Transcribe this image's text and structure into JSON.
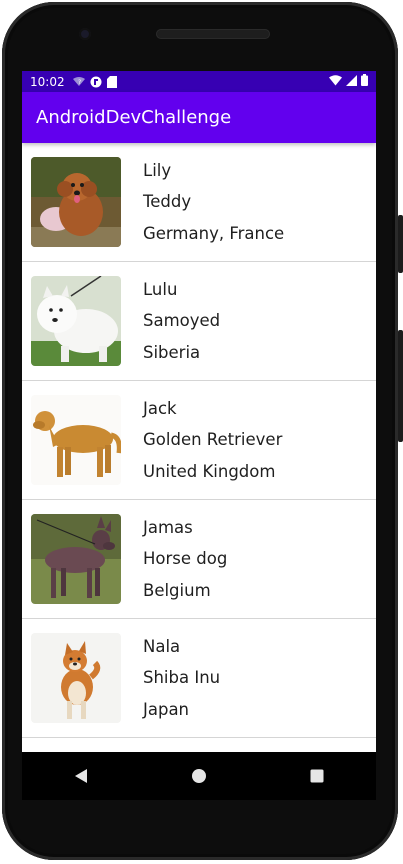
{
  "status_bar": {
    "time": "10:02",
    "icons_left": [
      "wifi-question-icon",
      "app-notification-icon",
      "sd-card-icon"
    ],
    "icons_right": [
      "wifi-icon",
      "signal-icon",
      "battery-icon"
    ]
  },
  "app_bar": {
    "title": "AndroidDevChallenge",
    "color": "#6200ee",
    "status_color": "#3700b3"
  },
  "dogs": [
    {
      "name": "Lily",
      "breed": "Teddy",
      "origin": "Germany, France",
      "image": "brown-poodle-photo"
    },
    {
      "name": "Lulu",
      "breed": "Samoyed",
      "origin": "Siberia",
      "image": "white-samoyed-photo"
    },
    {
      "name": "Jack",
      "breed": "Golden Retriever",
      "origin": "United Kingdom",
      "image": "golden-retriever-photo"
    },
    {
      "name": "Jamas",
      "breed": "Horse dog",
      "origin": "Belgium",
      "image": "hairless-dog-photo"
    },
    {
      "name": "Nala",
      "breed": "Shiba Inu",
      "origin": "Japan",
      "image": "shiba-inu-photo"
    }
  ],
  "nav_bar": {
    "buttons": [
      "back-icon",
      "home-icon",
      "recents-icon"
    ]
  }
}
